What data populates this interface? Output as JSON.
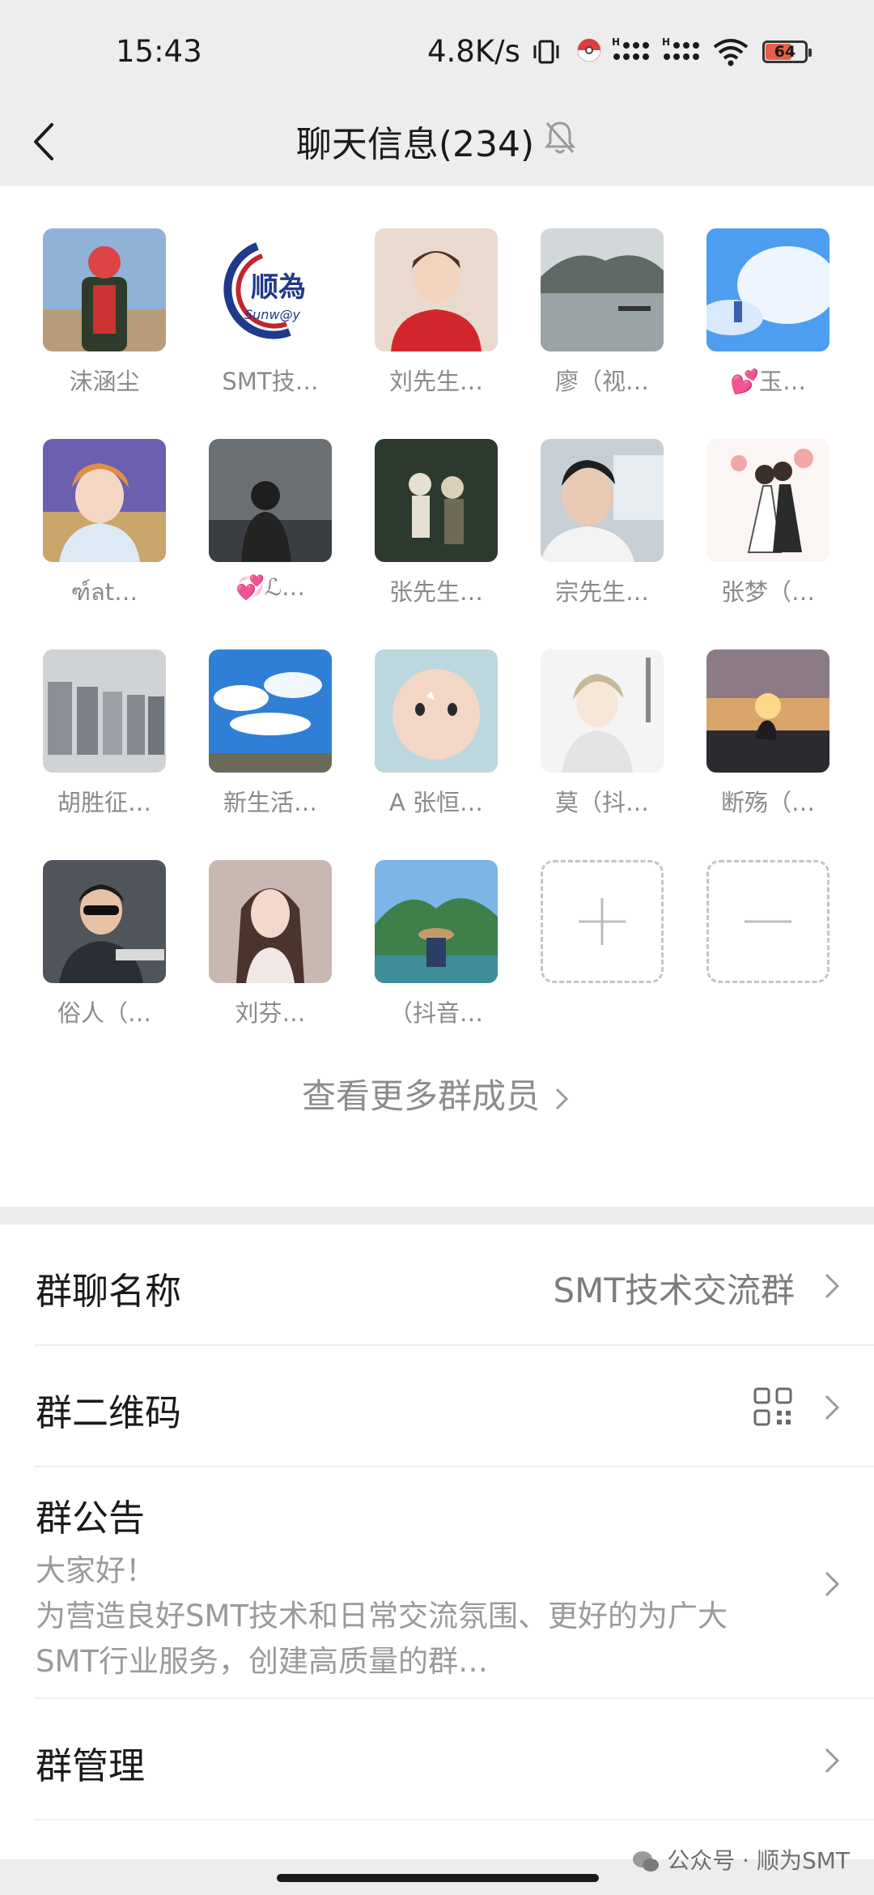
{
  "status_bar": {
    "time": "15:43",
    "net_speed": "4.8K/s",
    "battery": "64",
    "battery_level": 0.64
  },
  "header": {
    "title": "聊天信息(234)"
  },
  "members": [
    {
      "name": "沫涵尘",
      "avatar": "person-avatar"
    },
    {
      "name": "SMT技…",
      "avatar": "logo-avatar"
    },
    {
      "name": "刘先生…",
      "avatar": "person-avatar"
    },
    {
      "name": "廖（视…",
      "avatar": "landscape-avatar"
    },
    {
      "name": "💕玉…",
      "avatar": "cloud-avatar"
    },
    {
      "name": "ฑ์ลt…",
      "avatar": "person-avatar"
    },
    {
      "name": "💞ℒ…",
      "avatar": "person-avatar"
    },
    {
      "name": "张先生…",
      "avatar": "person-avatar"
    },
    {
      "name": "宗先生…",
      "avatar": "person-avatar"
    },
    {
      "name": "张梦（…",
      "avatar": "illustration-avatar"
    },
    {
      "name": "胡胜征…",
      "avatar": "factory-avatar"
    },
    {
      "name": "新生活…",
      "avatar": "sky-avatar"
    },
    {
      "name": "A 张恒…",
      "avatar": "baby-avatar"
    },
    {
      "name": "莫（抖…",
      "avatar": "anime-avatar"
    },
    {
      "name": "断殇（…",
      "avatar": "sunset-avatar"
    },
    {
      "name": "俗人（…",
      "avatar": "child-avatar"
    },
    {
      "name": "刘芬…",
      "avatar": "portrait-avatar"
    },
    {
      "name": "（抖音…",
      "avatar": "mountain-avatar"
    }
  ],
  "see_more": "查看更多群成员",
  "settings": {
    "group_name_label": "群聊名称",
    "group_name_value": "SMT技术交流群",
    "qr_label": "群二维码",
    "notice_label": "群公告",
    "notice_lines": [
      "大家好！",
      "为营造良好SMT技术和日常交流氛围、更好的为广大",
      "SMT行业服务，创建高质量的群…"
    ],
    "manage_label": "群管理"
  },
  "watermark": "公众号 · 顺为SMT",
  "colors": {
    "header_bg": "#ededed",
    "secondary_text": "#8a8a8a",
    "logo_blue": "#1f3a8a",
    "logo_red": "#c0262d"
  }
}
